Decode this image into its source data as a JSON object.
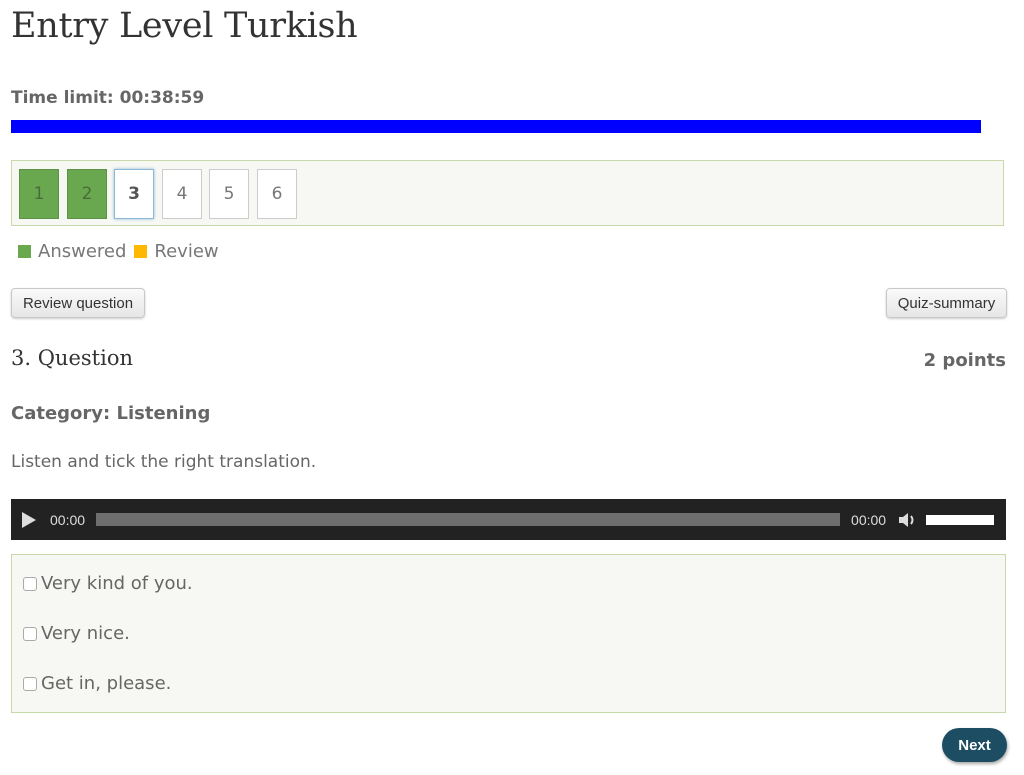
{
  "quiz": {
    "title": "Entry Level Turkish",
    "time_limit_label": "Time limit: 00:38:59",
    "time_remaining_fraction": 0.975,
    "timebar_color": "#0000ff"
  },
  "navigation": {
    "questions": [
      {
        "label": "1",
        "state": "answered"
      },
      {
        "label": "2",
        "state": "answered"
      },
      {
        "label": "3",
        "state": "current"
      },
      {
        "label": "4",
        "state": "unanswered"
      },
      {
        "label": "5",
        "state": "unanswered"
      },
      {
        "label": "6",
        "state": "unanswered"
      }
    ],
    "legend": [
      {
        "label": "Answered",
        "color": "#6aa84f"
      },
      {
        "label": "Review",
        "color": "#ffb800"
      }
    ]
  },
  "toolbar": {
    "review_label": "Review question",
    "summary_label": "Quiz-summary"
  },
  "question": {
    "heading": "3. Question",
    "points": "2 points",
    "category": "Category: Listening",
    "instruction": "Listen and tick the right translation.",
    "audio": {
      "current_time": "00:00",
      "duration": "00:00",
      "play_icon": "play-icon",
      "volume_icon": "volume-icon"
    },
    "answers": [
      {
        "label": "Very kind of you.",
        "checked": false
      },
      {
        "label": "Very nice.",
        "checked": false
      },
      {
        "label": "Get in, please.",
        "checked": false
      }
    ]
  },
  "footer": {
    "next_label": "Next"
  }
}
